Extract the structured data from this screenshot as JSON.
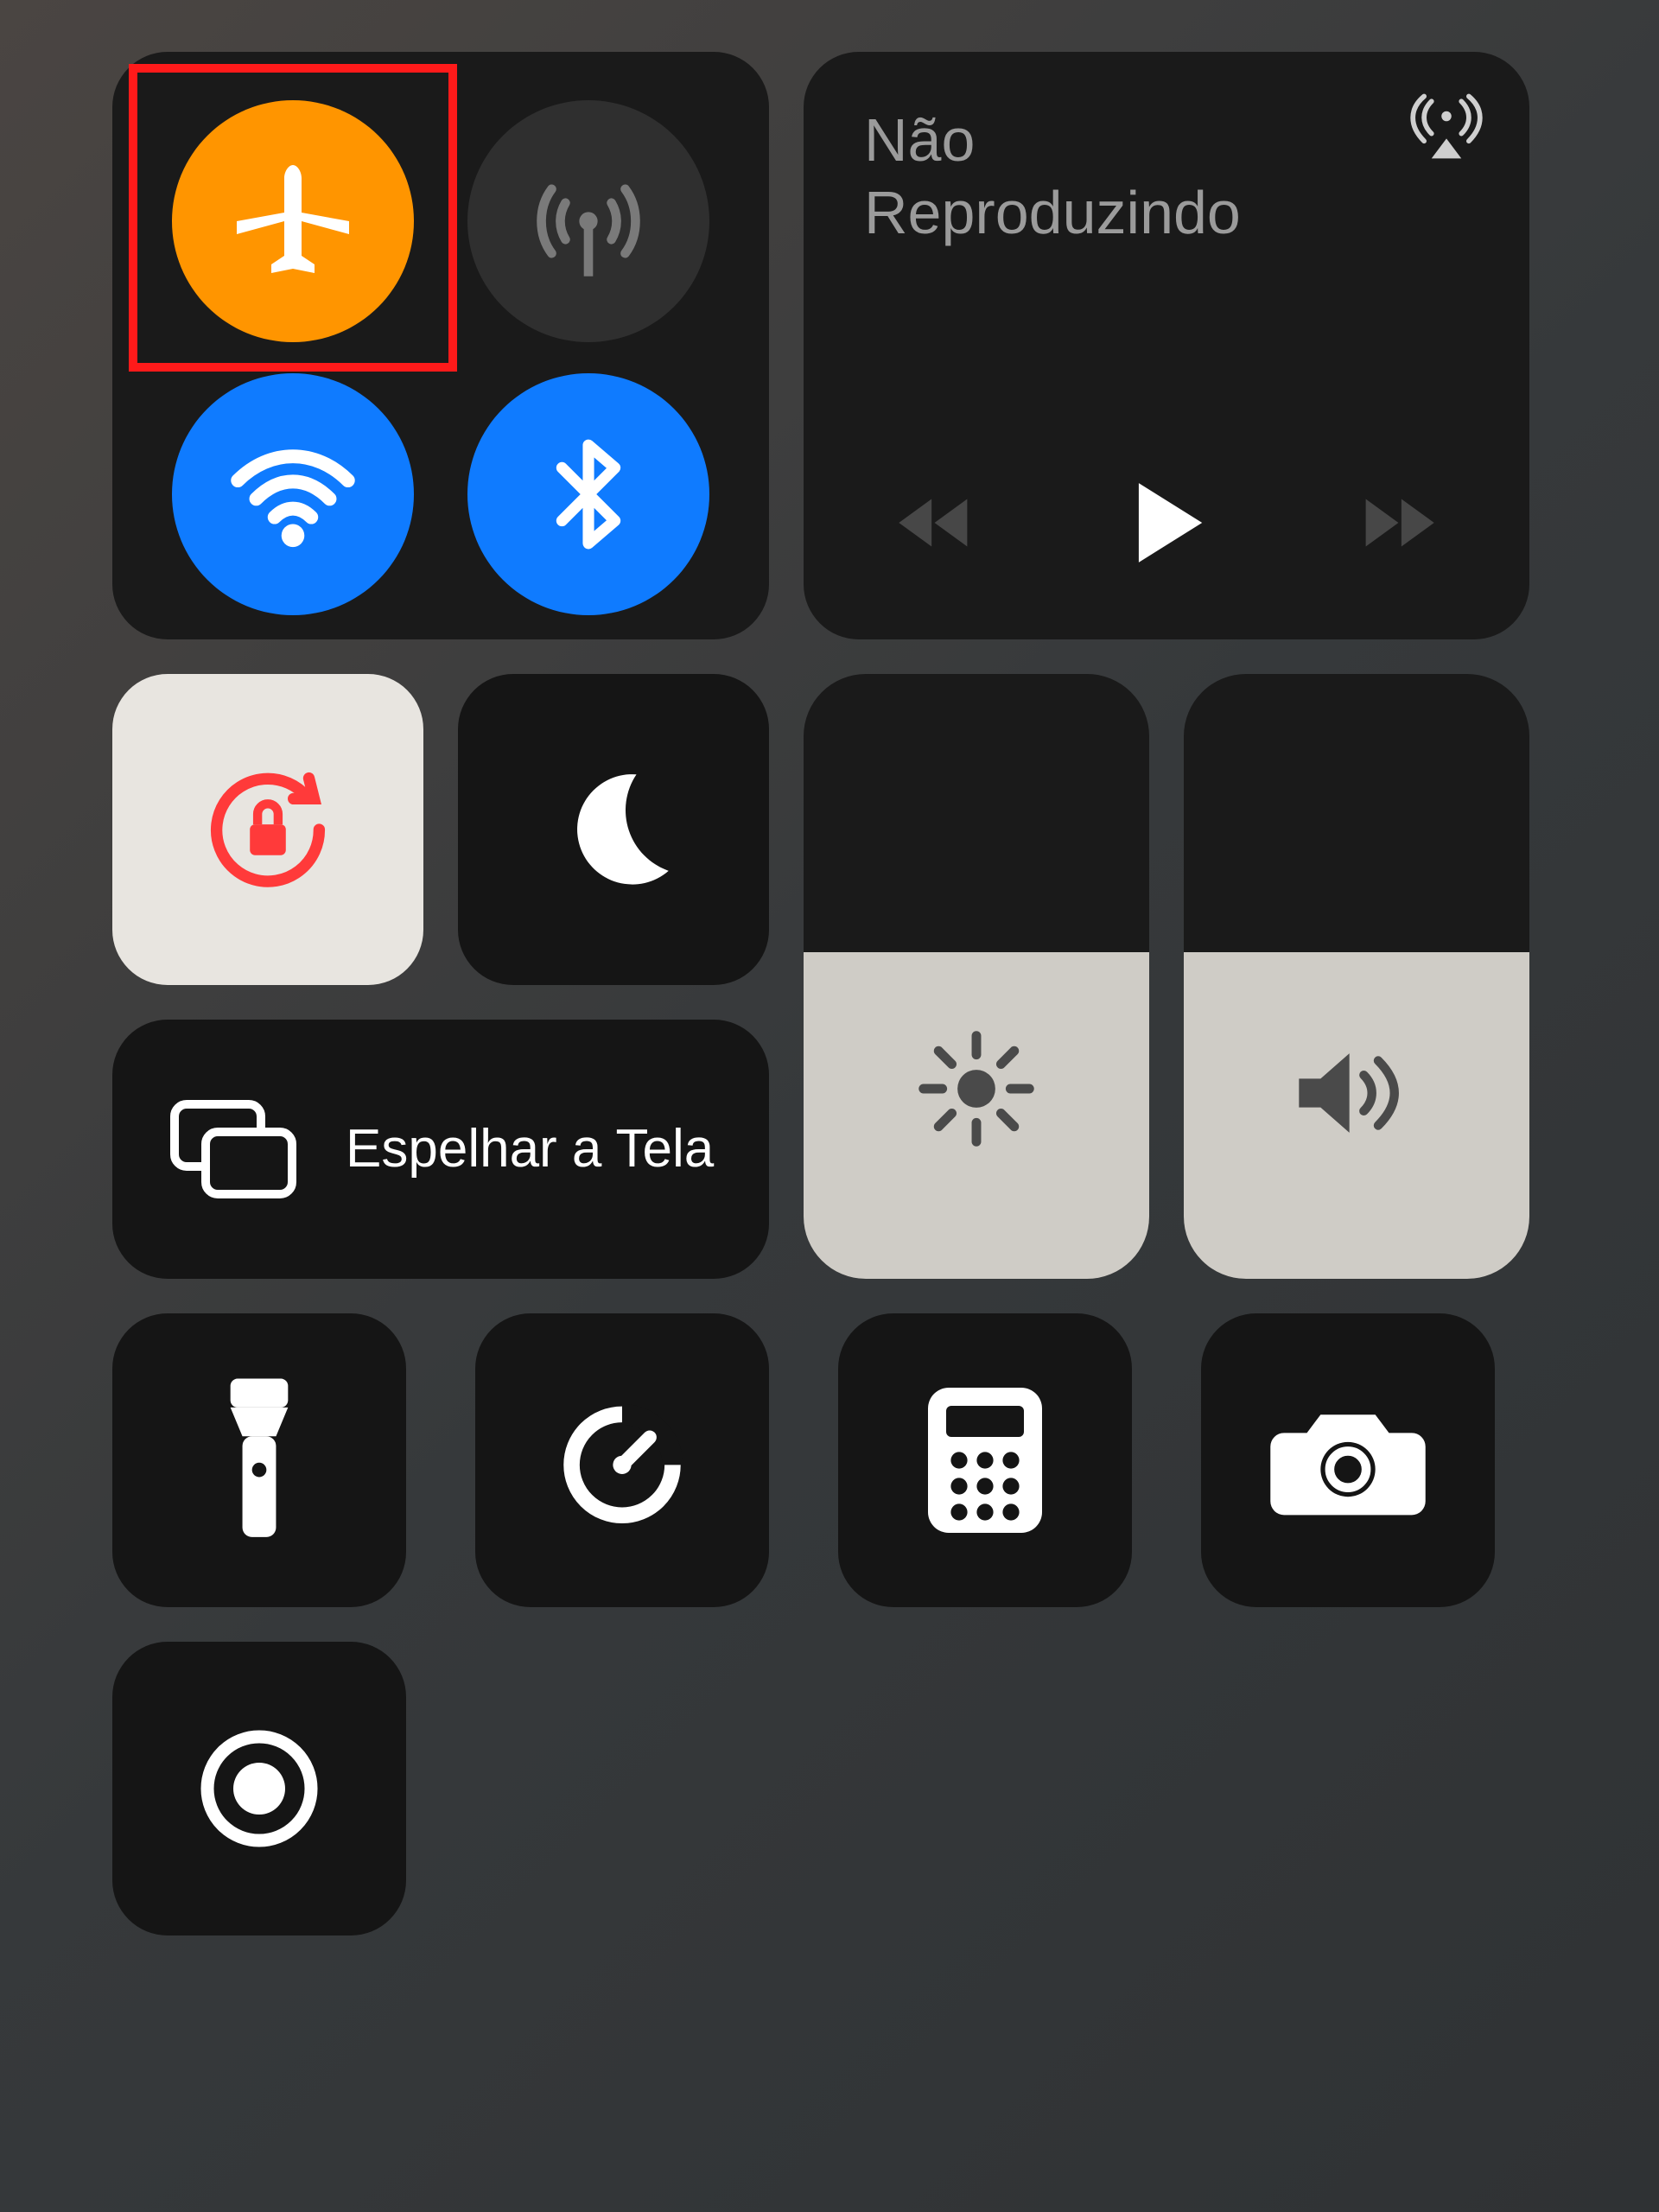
{
  "connectivity": {
    "airplane": {
      "active": true,
      "highlighted": true,
      "color": "#ff9500"
    },
    "cellular": {
      "active": false,
      "color": "#2f2f2f"
    },
    "wifi": {
      "active": true,
      "color": "#0f7bff"
    },
    "bluetooth": {
      "active": true,
      "color": "#0f7bff"
    }
  },
  "media": {
    "now_playing_label": "Não Reproduzindo",
    "airplay_available": true
  },
  "toggles": {
    "orientation_lock": {
      "active": true
    },
    "do_not_disturb": {
      "active": false
    }
  },
  "screen_mirroring": {
    "label": "Espelhar a Tela"
  },
  "sliders": {
    "brightness": {
      "percent": 54
    },
    "volume": {
      "percent": 54
    }
  },
  "shortcuts": {
    "flashlight": {
      "active": false
    },
    "timer": {},
    "calculator": {},
    "camera": {},
    "screen_record": {
      "recording": false
    }
  },
  "colors": {
    "highlight_box": "#ff1a1a",
    "orientation_lock_icon": "#ff3a3a",
    "panel_bg": "#1a1a1a",
    "light_panel_bg": "#e8e5e0"
  }
}
